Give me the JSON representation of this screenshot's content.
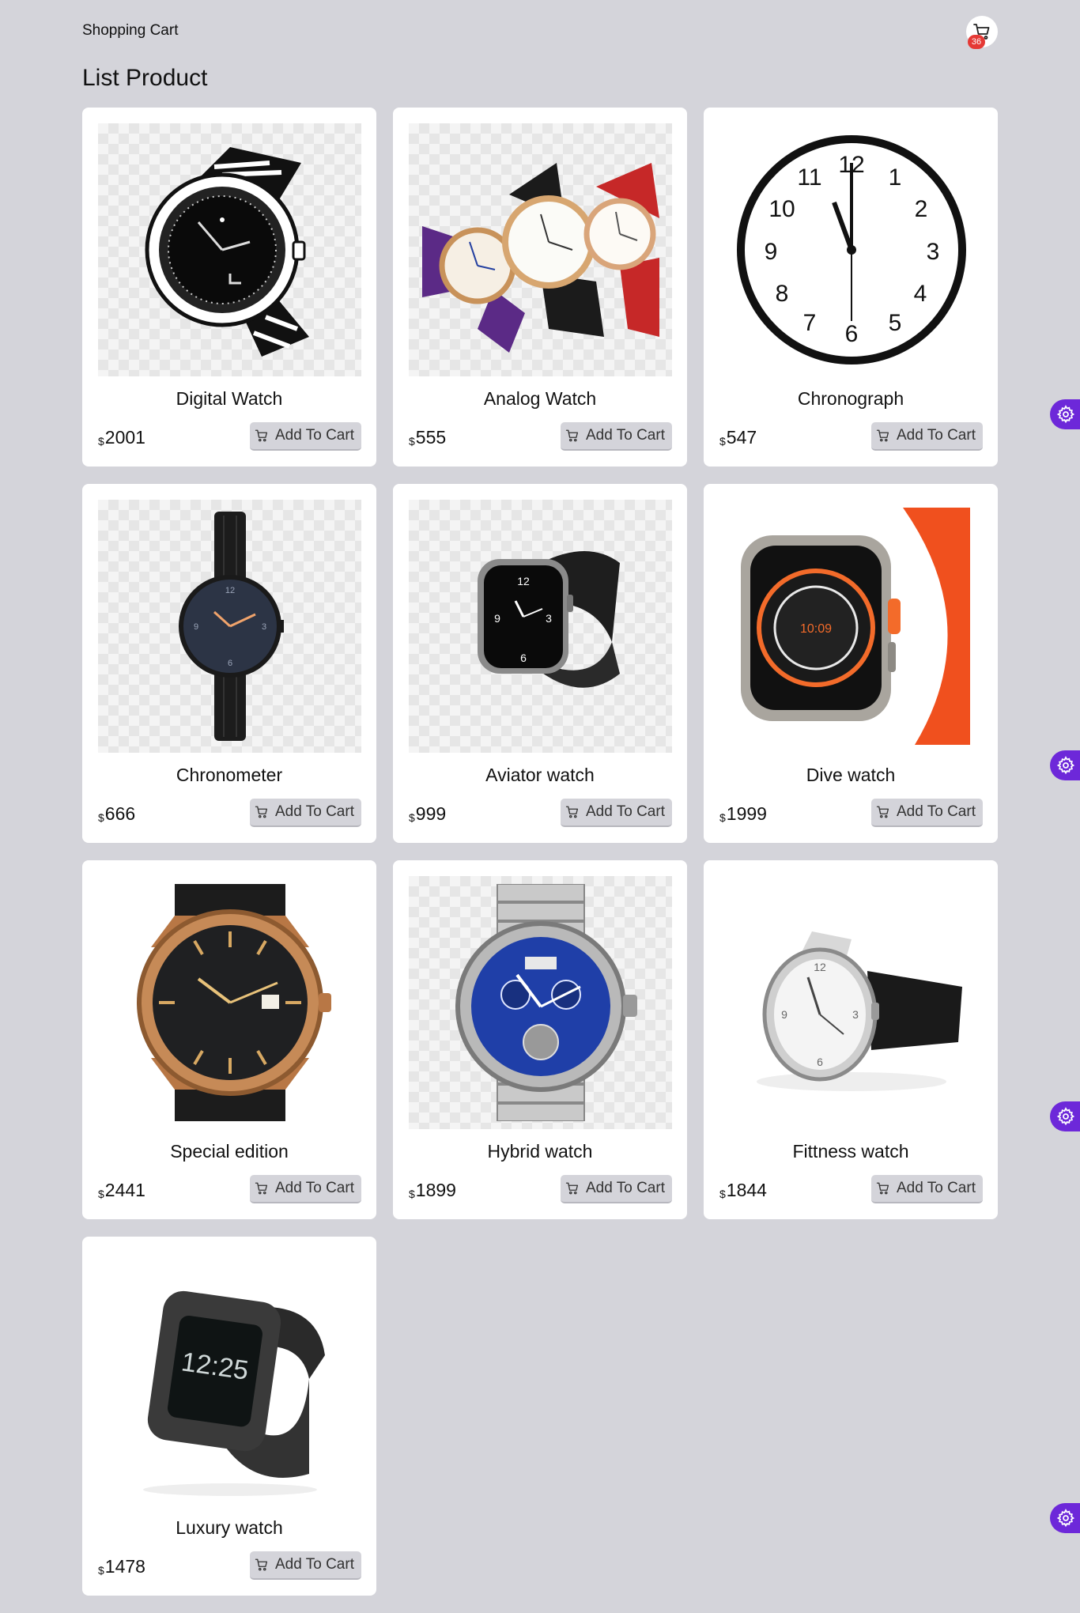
{
  "header": {
    "brand": "Shopping Cart",
    "cart_count": "36"
  },
  "page": {
    "title": "List Product"
  },
  "products": [
    {
      "name": "Digital Watch",
      "currency": "$",
      "price": "2001",
      "button": "Add To Cart",
      "image": "digital-watch-image"
    },
    {
      "name": "Analog Watch",
      "currency": "$",
      "price": "555",
      "button": "Add To Cart",
      "image": "analog-watch-image"
    },
    {
      "name": "Chronograph",
      "currency": "$",
      "price": "547",
      "button": "Add To Cart",
      "image": "chronograph-image"
    },
    {
      "name": "Chronometer",
      "currency": "$",
      "price": "666",
      "button": "Add To Cart",
      "image": "chronometer-image"
    },
    {
      "name": "Aviator watch",
      "currency": "$",
      "price": "999",
      "button": "Add To Cart",
      "image": "aviator-watch-image"
    },
    {
      "name": "Dive watch",
      "currency": "$",
      "price": "1999",
      "button": "Add To Cart",
      "image": "dive-watch-image"
    },
    {
      "name": "Special edition",
      "currency": "$",
      "price": "2441",
      "button": "Add To Cart",
      "image": "special-edition-image"
    },
    {
      "name": "Hybrid watch",
      "currency": "$",
      "price": "1899",
      "button": "Add To Cart",
      "image": "hybrid-watch-image"
    },
    {
      "name": "Fittness watch",
      "currency": "$",
      "price": "1844",
      "button": "Add To Cart",
      "image": "fitness-watch-image"
    },
    {
      "name": "Luxury watch",
      "currency": "$",
      "price": "1478",
      "button": "Add To Cart",
      "image": "luxury-watch-image"
    }
  ],
  "icons": {
    "cart": "cart-icon",
    "settings": "gear-icon"
  },
  "colors": {
    "background": "#d4d4da",
    "card": "#ffffff",
    "badge": "#e53935",
    "settings_tab": "#6d28d9"
  }
}
